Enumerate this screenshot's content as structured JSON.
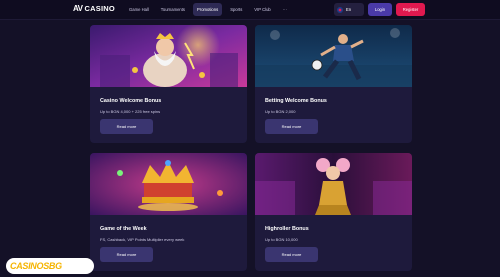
{
  "header": {
    "logo_mark": "AV",
    "logo_text": "CASINO",
    "nav": [
      "Game Hall",
      "Tournaments",
      "Promotions",
      "Sports",
      "VIP Club",
      "···"
    ],
    "active_nav_index": 2,
    "lang": "En",
    "login": "Login",
    "register": "Register"
  },
  "promos": [
    {
      "title": "Casino Welcome Bonus",
      "subtitle": "Up to BGN 4,000 + 225 free spins",
      "button": "Read more",
      "image": "zeus-figure"
    },
    {
      "title": "Betting Welcome Bonus",
      "subtitle": "Up to BGN 2,000",
      "button": "Read more",
      "image": "soccer-player"
    },
    {
      "title": "Game of the Week",
      "subtitle": "FS, Cashback, VIP Points Multiplier every week",
      "button": "Read more",
      "image": "crown"
    },
    {
      "title": "Highroller Bonus",
      "subtitle": "Up to BGN 10,000",
      "button": "Read more",
      "image": "gold-lady"
    }
  ],
  "watermark": {
    "text": "CASINOS",
    "suffix": "BG"
  },
  "colors": {
    "accent": "#e0194f",
    "login": "#4a3aa8",
    "card": "#1e1a3c",
    "background": "#141127"
  }
}
